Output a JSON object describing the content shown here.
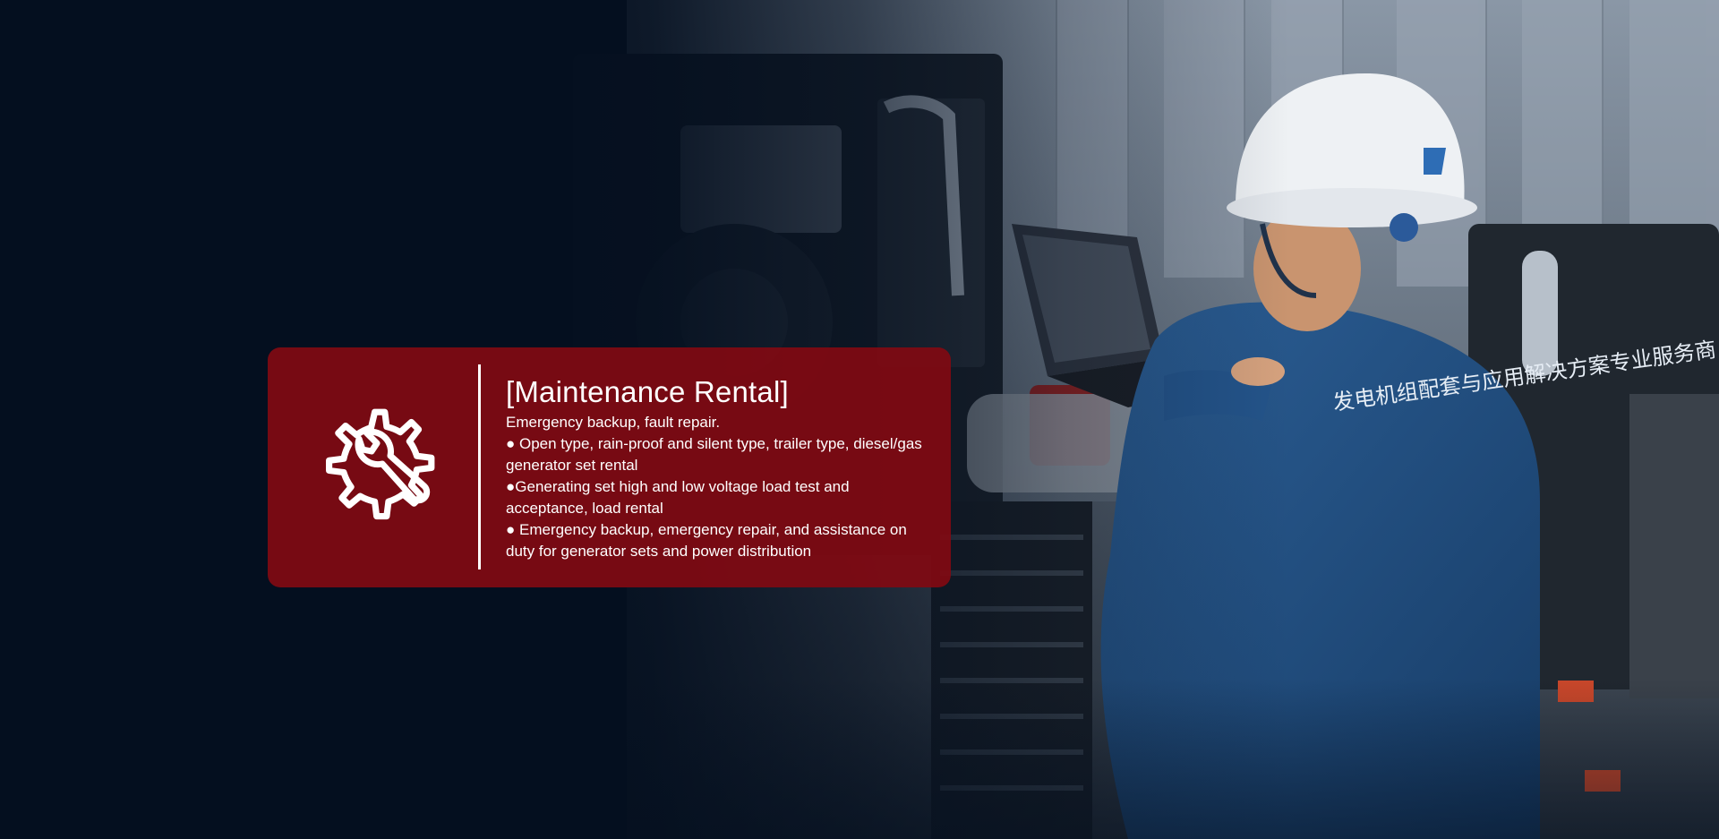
{
  "card": {
    "icon": "gear-wrench-icon",
    "title": "[Maintenance Rental]",
    "lines": [
      "Emergency backup, fault repair.",
      "● Open type, rain-proof and silent type, trailer type, diesel/gas generator set rental",
      "●Generating set high and low voltage load test and acceptance, load rental",
      "● Emergency backup, emergency repair, and assistance on duty for generator sets and power distribution"
    ]
  },
  "background": {
    "uniform_text": "发电机组配套与应用解决方案专业服务商"
  },
  "colors": {
    "card_red": "#800a12",
    "page_navy": "#07111f",
    "text_white": "#ffffff"
  }
}
